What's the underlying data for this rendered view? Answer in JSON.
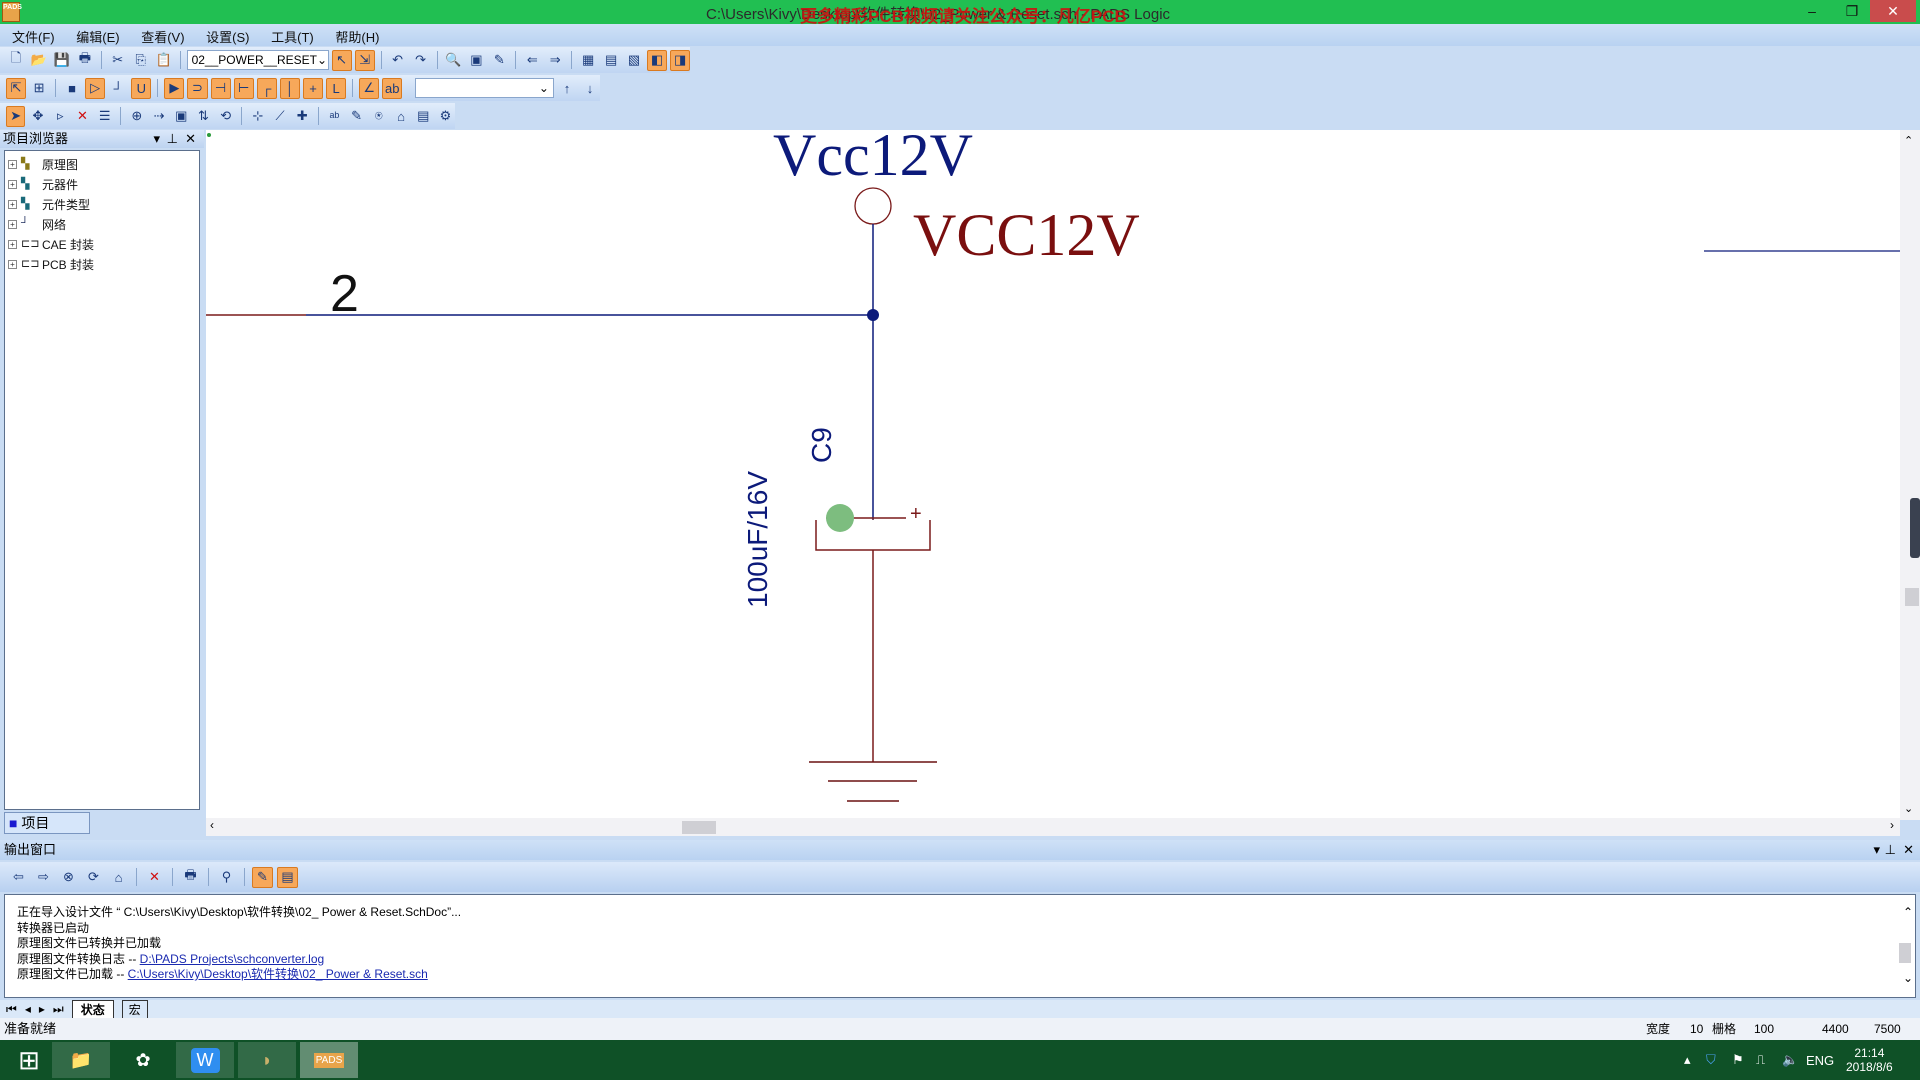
{
  "window": {
    "title": "C:\\Users\\Kivy\\Desktop\\软件转换\\02_Power & Reset.sch - PADS Logic",
    "overlay": "更多精彩PCB视频请关注公众号：凡亿PCB",
    "icon": "pads-app-icon",
    "minimize": "–",
    "restore": "❐",
    "close": "✕"
  },
  "menu": [
    "文件(F)",
    "编辑(E)",
    "查看(V)",
    "设置(S)",
    "工具(T)",
    "帮助(H)"
  ],
  "toolbar": {
    "sheet_select": "02__POWER__RESET",
    "net_select": ""
  },
  "project_browser": {
    "title": "项目浏览器",
    "items": [
      "原理图",
      "元器件",
      "元件类型",
      "网络",
      "CAE 封装",
      "PCB 封装"
    ],
    "tab": "项目"
  },
  "schematic": {
    "power_label": "Vcc12V",
    "net_label": "VCC12V",
    "pin_number": "2",
    "ref_des": "C9",
    "value": "100uF/16V",
    "plus": "+"
  },
  "output": {
    "title": "输出窗口",
    "lines": [
      {
        "text": "正在导入设计文件 “ C:\\Users\\Kivy\\Desktop\\软件转换\\02_ Power & Reset.SchDoc”..."
      },
      {
        "text": "转换器已启动"
      },
      {
        "text": "原理图文件已转换并已加载"
      },
      {
        "text": "原理图文件转换日志  -- ",
        "link": "D:\\PADS Projects\\schconverter.log"
      },
      {
        "text": "原理图文件已加载  -- ",
        "link": "C:\\Users\\Kivy\\Desktop\\软件转换\\02_ Power & Reset.sch"
      }
    ],
    "tabs": [
      "状态",
      "宏"
    ]
  },
  "status": {
    "text": "准备就绪",
    "width_label": "宽度",
    "width": "10",
    "grid_label": "栅格",
    "grid": "100",
    "x": "4400",
    "y": "7500"
  },
  "tray": {
    "lang": "ENG",
    "time": "21:14",
    "date": "2018/8/6"
  }
}
